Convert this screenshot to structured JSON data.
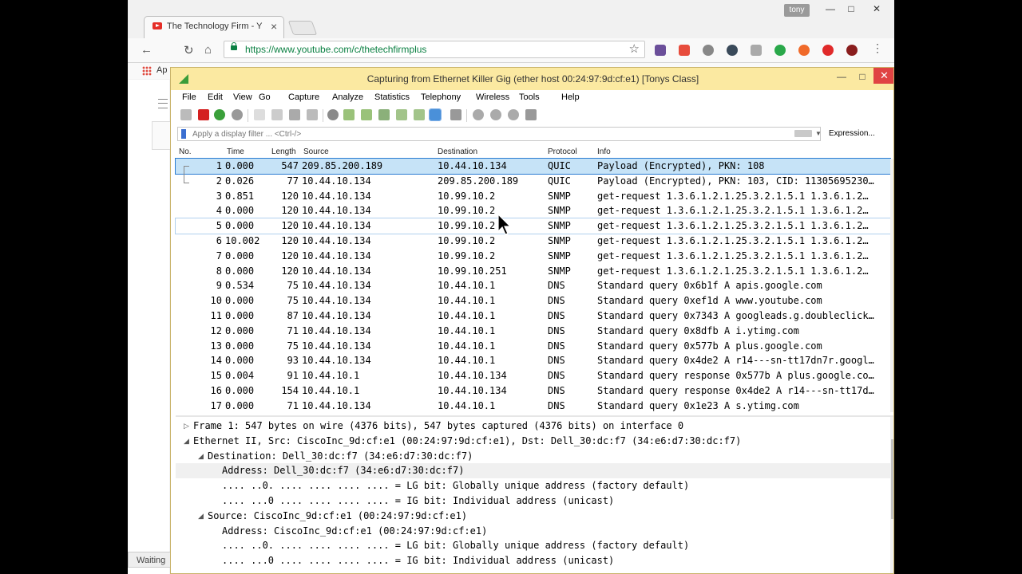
{
  "browser": {
    "tab_title": "The Technology Firm - Y",
    "user": "tony",
    "url": "https://www.youtube.com/c/thetechfirmplus",
    "apps_label": "Ap",
    "status": "Waiting"
  },
  "wireshark": {
    "title": "Capturing from Ethernet Killer Gig (ether host 00:24:97:9d:cf:e1) [Tonys Class]",
    "menu": [
      "File",
      "Edit",
      "View",
      "Go",
      "Capture",
      "Analyze",
      "Statistics",
      "Telephony",
      "Wireless",
      "Tools",
      "Help"
    ],
    "filter_placeholder": "Apply a display filter ... <Ctrl-/>",
    "expression_label": "Expression...",
    "columns": [
      "No.",
      "Time",
      "Length",
      "Source",
      "Destination",
      "Protocol",
      "Info"
    ],
    "packets": [
      {
        "no": "1",
        "time": "0.000",
        "len": "547",
        "src": "209.85.200.189",
        "dst": "10.44.10.134",
        "proto": "QUIC",
        "info": "Payload (Encrypted), PKN: 108"
      },
      {
        "no": "2",
        "time": "0.026",
        "len": "77",
        "src": "10.44.10.134",
        "dst": "209.85.200.189",
        "proto": "QUIC",
        "info": "Payload (Encrypted), PKN: 103, CID: 11305695230…"
      },
      {
        "no": "3",
        "time": "0.851",
        "len": "120",
        "src": "10.44.10.134",
        "dst": "10.99.10.2",
        "proto": "SNMP",
        "info": "get-request 1.3.6.1.2.1.25.3.2.1.5.1 1.3.6.1.2…"
      },
      {
        "no": "4",
        "time": "0.000",
        "len": "120",
        "src": "10.44.10.134",
        "dst": "10.99.10.2",
        "proto": "SNMP",
        "info": "get-request 1.3.6.1.2.1.25.3.2.1.5.1 1.3.6.1.2…"
      },
      {
        "no": "5",
        "time": "0.000",
        "len": "120",
        "src": "10.44.10.134",
        "dst": "10.99.10.2",
        "proto": "SNMP",
        "info": "get-request 1.3.6.1.2.1.25.3.2.1.5.1 1.3.6.1.2…"
      },
      {
        "no": "6",
        "time": "10.002",
        "len": "120",
        "src": "10.44.10.134",
        "dst": "10.99.10.2",
        "proto": "SNMP",
        "info": "get-request 1.3.6.1.2.1.25.3.2.1.5.1 1.3.6.1.2…"
      },
      {
        "no": "7",
        "time": "0.000",
        "len": "120",
        "src": "10.44.10.134",
        "dst": "10.99.10.2",
        "proto": "SNMP",
        "info": "get-request 1.3.6.1.2.1.25.3.2.1.5.1 1.3.6.1.2…"
      },
      {
        "no": "8",
        "time": "0.000",
        "len": "120",
        "src": "10.44.10.134",
        "dst": "10.99.10.251",
        "proto": "SNMP",
        "info": "get-request 1.3.6.1.2.1.25.3.2.1.5.1 1.3.6.1.2…"
      },
      {
        "no": "9",
        "time": "0.534",
        "len": "75",
        "src": "10.44.10.134",
        "dst": "10.44.10.1",
        "proto": "DNS",
        "info": "Standard query 0x6b1f A apis.google.com"
      },
      {
        "no": "10",
        "time": "0.000",
        "len": "75",
        "src": "10.44.10.134",
        "dst": "10.44.10.1",
        "proto": "DNS",
        "info": "Standard query 0xef1d A www.youtube.com"
      },
      {
        "no": "11",
        "time": "0.000",
        "len": "87",
        "src": "10.44.10.134",
        "dst": "10.44.10.1",
        "proto": "DNS",
        "info": "Standard query 0x7343 A googleads.g.doubleclick…"
      },
      {
        "no": "12",
        "time": "0.000",
        "len": "71",
        "src": "10.44.10.134",
        "dst": "10.44.10.1",
        "proto": "DNS",
        "info": "Standard query 0x8dfb A i.ytimg.com"
      },
      {
        "no": "13",
        "time": "0.000",
        "len": "75",
        "src": "10.44.10.134",
        "dst": "10.44.10.1",
        "proto": "DNS",
        "info": "Standard query 0x577b A plus.google.com"
      },
      {
        "no": "14",
        "time": "0.000",
        "len": "93",
        "src": "10.44.10.134",
        "dst": "10.44.10.1",
        "proto": "DNS",
        "info": "Standard query 0x4de2 A r14---sn-tt17dn7r.googl…"
      },
      {
        "no": "15",
        "time": "0.004",
        "len": "91",
        "src": "10.44.10.1",
        "dst": "10.44.10.134",
        "proto": "DNS",
        "info": "Standard query response 0x577b A plus.google.co…"
      },
      {
        "no": "16",
        "time": "0.000",
        "len": "154",
        "src": "10.44.10.1",
        "dst": "10.44.10.134",
        "proto": "DNS",
        "info": "Standard query response 0x4de2 A r14---sn-tt17d…"
      },
      {
        "no": "17",
        "time": "0.000",
        "len": "71",
        "src": "10.44.10.134",
        "dst": "10.44.10.1",
        "proto": "DNS",
        "info": "Standard query 0x1e23 A s.ytimg.com"
      }
    ],
    "details": [
      {
        "text": "Frame 1: 547 bytes on wire (4376 bits), 547 bytes captured (4376 bits) on interface 0",
        "arrow": "▷"
      },
      {
        "text": "Ethernet II, Src: CiscoInc_9d:cf:e1 (00:24:97:9d:cf:e1), Dst: Dell_30:dc:f7 (34:e6:d7:30:dc:f7)",
        "arrow": "◢"
      },
      {
        "text": "Destination: Dell_30:dc:f7 (34:e6:d7:30:dc:f7)",
        "arrow": "◢"
      },
      {
        "text": "Address: Dell_30:dc:f7 (34:e6:d7:30:dc:f7)",
        "arrow": ""
      },
      {
        "text": ".... ..0. .... .... .... .... = LG bit: Globally unique address (factory default)",
        "arrow": ""
      },
      {
        "text": ".... ...0 .... .... .... .... = IG bit: Individual address (unicast)",
        "arrow": ""
      },
      {
        "text": "Source: CiscoInc_9d:cf:e1 (00:24:97:9d:cf:e1)",
        "arrow": "◢"
      },
      {
        "text": "Address: CiscoInc_9d:cf:e1 (00:24:97:9d:cf:e1)",
        "arrow": ""
      },
      {
        "text": ".... ..0. .... .... .... .... = LG bit: Globally unique address (factory default)",
        "arrow": ""
      },
      {
        "text": ".... ...0 .... .... .... .... = IG bit: Individual address (unicast)",
        "arrow": ""
      }
    ]
  },
  "colors": {
    "selected_row": "#c6e3f7",
    "title_bar": "#fbe9a1",
    "close": "#e04343"
  }
}
